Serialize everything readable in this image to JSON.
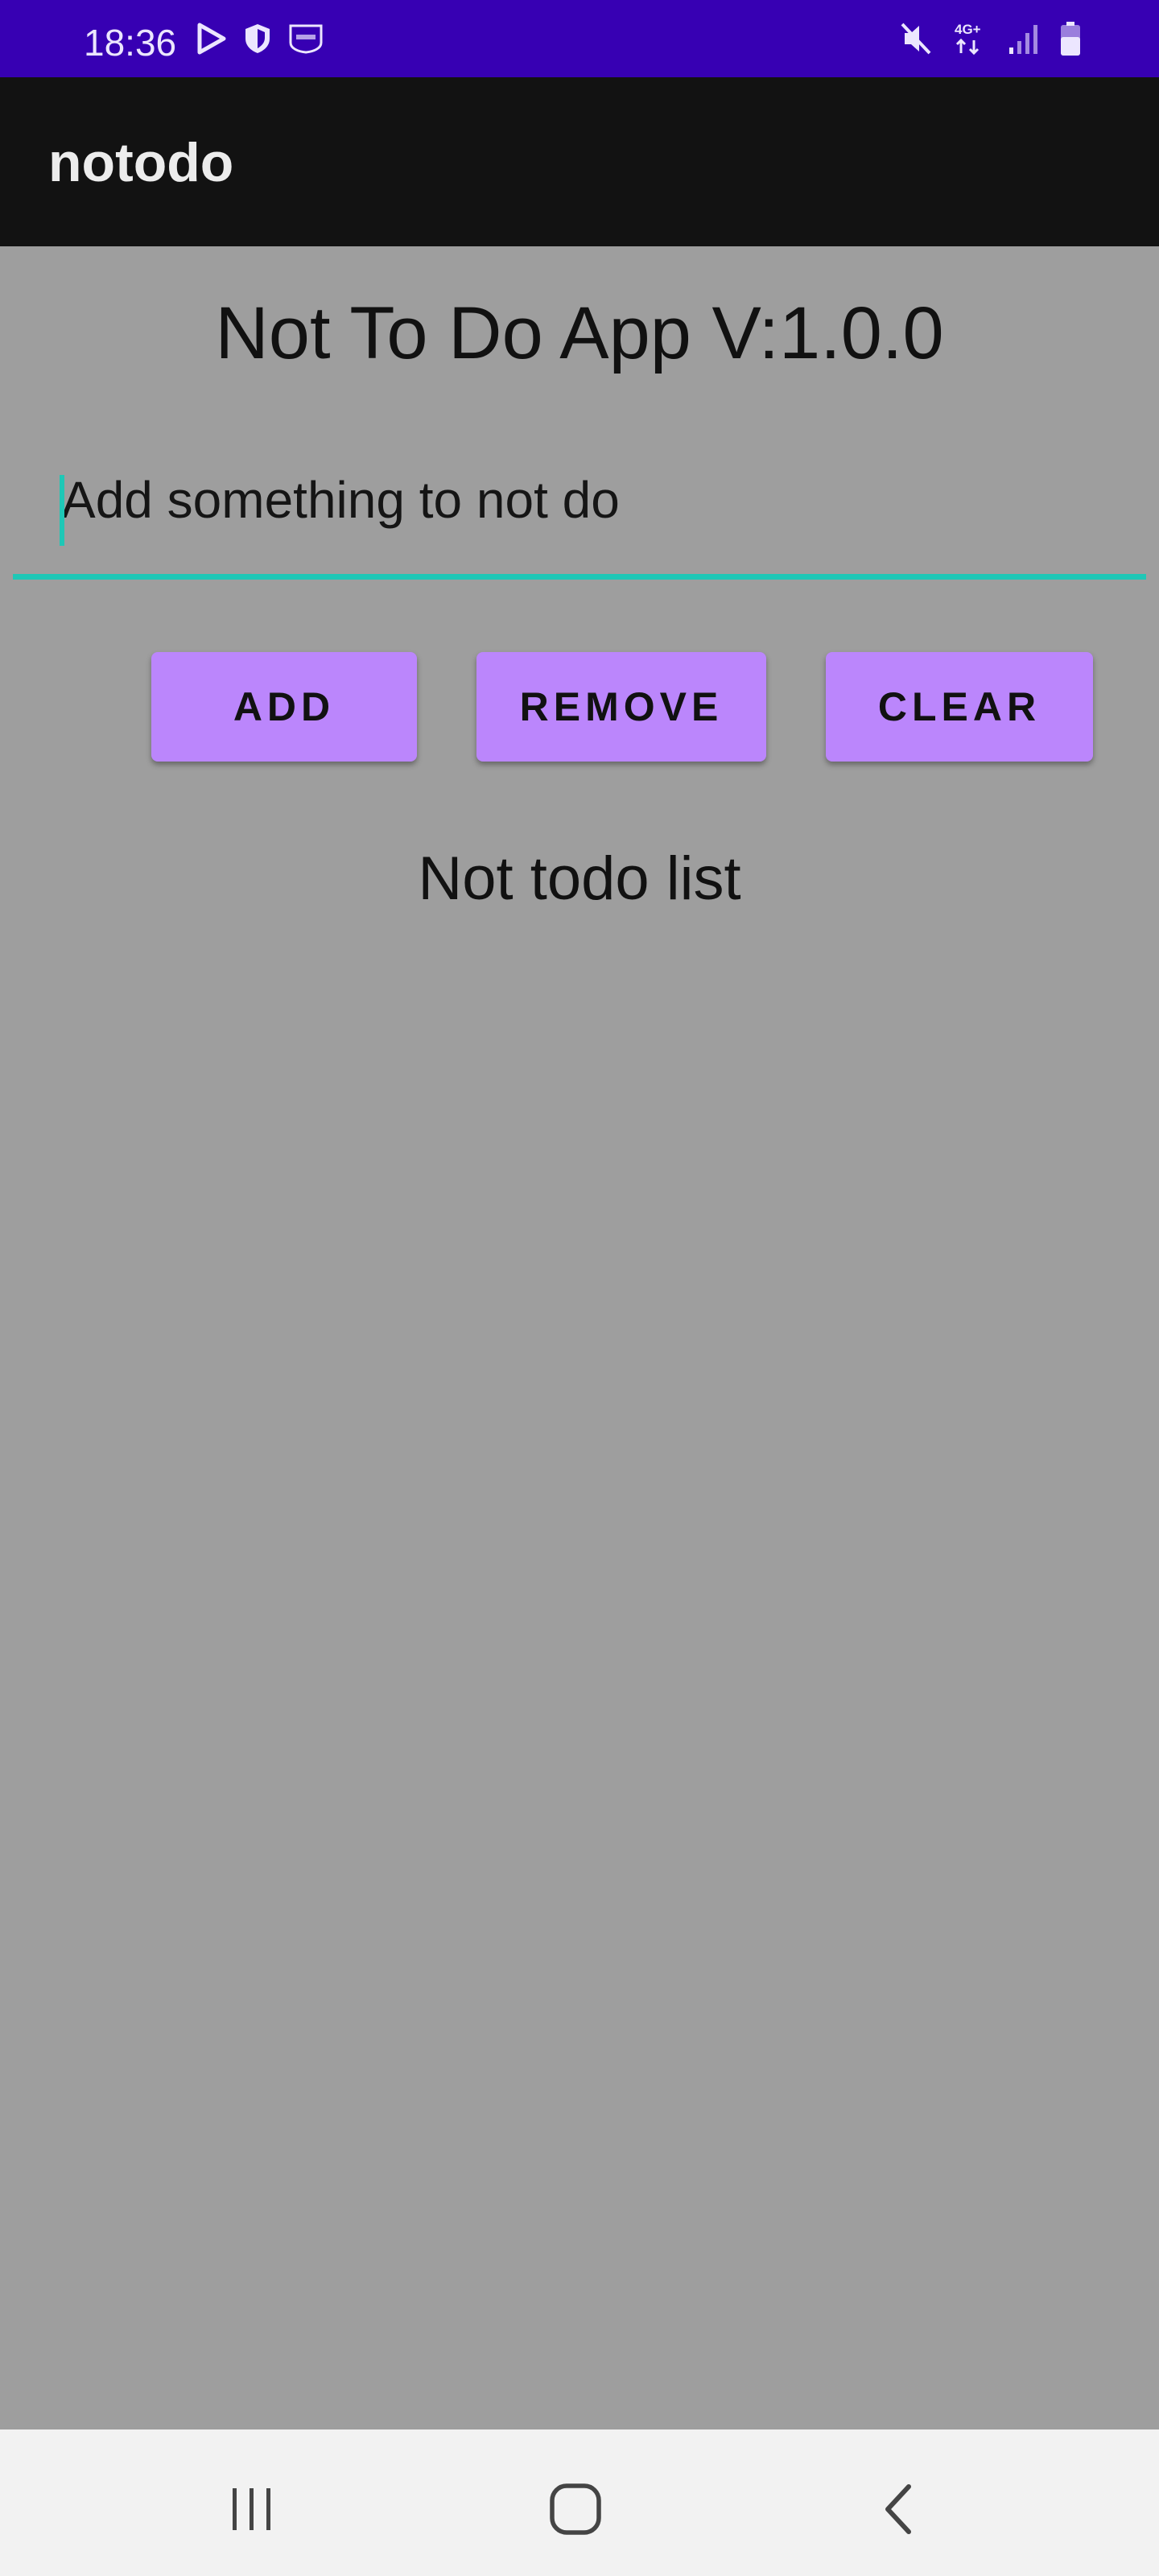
{
  "status_bar": {
    "time": "18:36",
    "left_icons": [
      "play-store-icon",
      "shield-icon",
      "vpn-badge-icon"
    ],
    "right_icons": [
      "mute-icon",
      "network-4g-icon",
      "signal-icon",
      "battery-icon"
    ],
    "network_label": "4G+",
    "background": "#3700b3"
  },
  "app_bar": {
    "title": "notodo",
    "background": "#121212"
  },
  "main": {
    "heading": "Not To Do App V:1.0.0",
    "input": {
      "value": "",
      "placeholder": "Add something to not do",
      "underline_color": "#1fc7b6"
    },
    "buttons": {
      "add_label": "ADD",
      "remove_label": "REMOVE",
      "clear_label": "CLEAR",
      "color": "#bb86fc"
    },
    "list_title": "Not todo list",
    "list_items": []
  },
  "nav_bar": {
    "buttons": [
      "recents-icon",
      "home-icon",
      "back-icon"
    ]
  }
}
